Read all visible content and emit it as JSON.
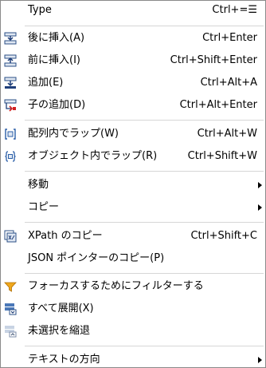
{
  "menu": {
    "items": [
      {
        "label": "Type",
        "shortcut": "Ctrl+=☰"
      },
      {
        "label": "後に挿入(A)",
        "shortcut": "Ctrl+Enter",
        "icon": "insert-after-icon"
      },
      {
        "label": "前に挿入(I)",
        "shortcut": "Ctrl+Shift+Enter",
        "icon": "insert-before-icon"
      },
      {
        "label": "追加(E)",
        "shortcut": "Ctrl+Alt+A",
        "icon": "append-icon"
      },
      {
        "label": "子の追加(D)",
        "shortcut": "Ctrl+Alt+Enter",
        "icon": "add-child-icon"
      },
      {
        "label": "配列内でラップ(W)",
        "shortcut": "Ctrl+Alt+W",
        "icon": "wrap-in-array-icon"
      },
      {
        "label": "オブジェクト内でラップ(R)",
        "shortcut": "Ctrl+Shift+W",
        "icon": "wrap-in-object-icon"
      },
      {
        "label": "移動",
        "submenu": true
      },
      {
        "label": "コピー",
        "submenu": true
      },
      {
        "label": "XPath のコピー",
        "shortcut": "Ctrl+Shift+C",
        "icon": "xpath-copy-icon"
      },
      {
        "label": "JSON ポインターのコピー(P)"
      },
      {
        "label": "フォーカスするためにフィルターする",
        "icon": "filter-funnel-icon"
      },
      {
        "label": "すべて展開(X)",
        "icon": "expand-all-icon"
      },
      {
        "label": "未選択を縮退",
        "icon": "collapse-unselected-icon"
      },
      {
        "label": "テキストの方向",
        "submenu": true
      }
    ]
  }
}
